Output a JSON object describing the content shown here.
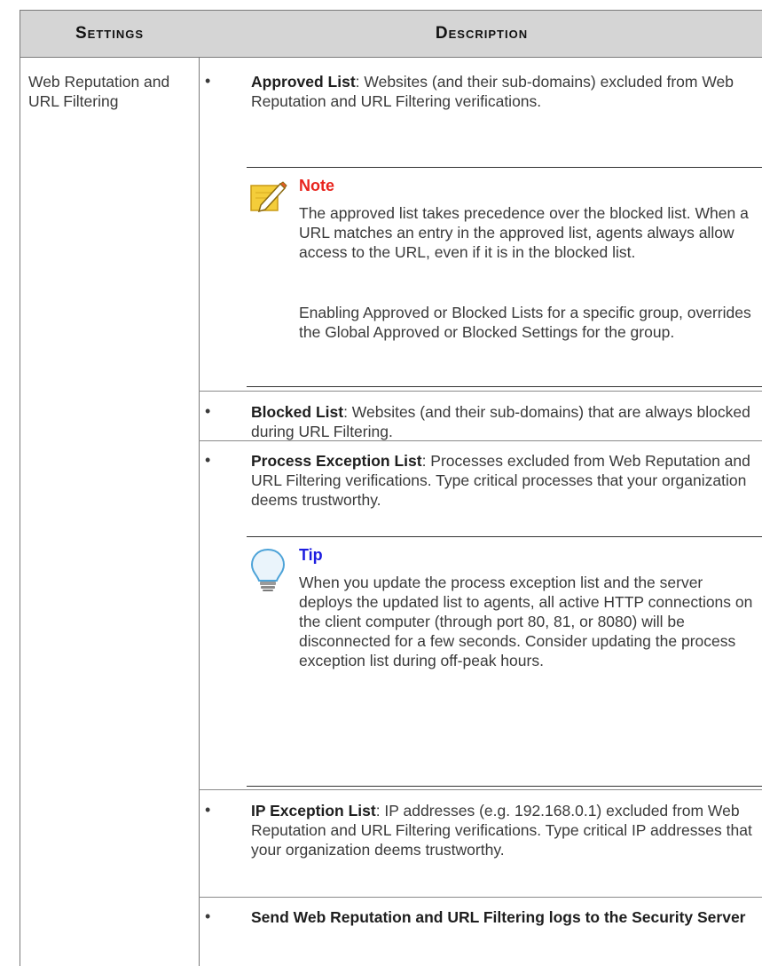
{
  "header": {
    "settings": "Settings",
    "description": "Description"
  },
  "row": {
    "label": "Web Reputation and URL Filtering"
  },
  "items": [
    {
      "bullet": "•",
      "bold": "Approved List",
      "text": ": Websites (and their sub-domains) excluded from Web Reputation and URL Filtering verifications."
    },
    {
      "bullet": "•",
      "bold": "Blocked List",
      "text": ": Websites (and their sub-domains) that are always blocked during URL Filtering."
    },
    {
      "bullet": "•",
      "bold": "Process Exception List",
      "text": ": Processes excluded from Web Reputation and URL Filtering verifications. Type critical processes that your organization deems trustworthy."
    },
    {
      "bullet": "•",
      "bold": "IP Exception List",
      "text": ": IP addresses (e.g. 192.168.0.1) excluded from Web Reputation and URL Filtering verifications. Type critical IP addresses that your organization deems trustworthy."
    },
    {
      "bullet": "•",
      "bold": "Send Web Reputation and URL Filtering logs to the Security Server",
      "text": ""
    }
  ],
  "note": {
    "title": "Note",
    "title_color": "#e8241d",
    "paragraphs": [
      "The approved list takes precedence over the blocked list. When a URL matches an entry in the approved list, agents always allow access to the URL, even if it is in the blocked list.",
      "Enabling Approved or Blocked Lists for a specific group, overrides the Global Approved or Blocked Settings for the group."
    ]
  },
  "tip": {
    "title": "Tip",
    "title_color": "#1d1de0",
    "paragraphs": [
      "When you update the process exception list and the server deploys the updated list to agents, all active HTTP connections on the client computer (through port 80, 81, or 8080) will be disconnected for a few seconds. Consider updating the process exception list during off-peak hours."
    ]
  },
  "icons": {
    "note": "pencil-note-icon",
    "tip": "lightbulb-icon"
  }
}
